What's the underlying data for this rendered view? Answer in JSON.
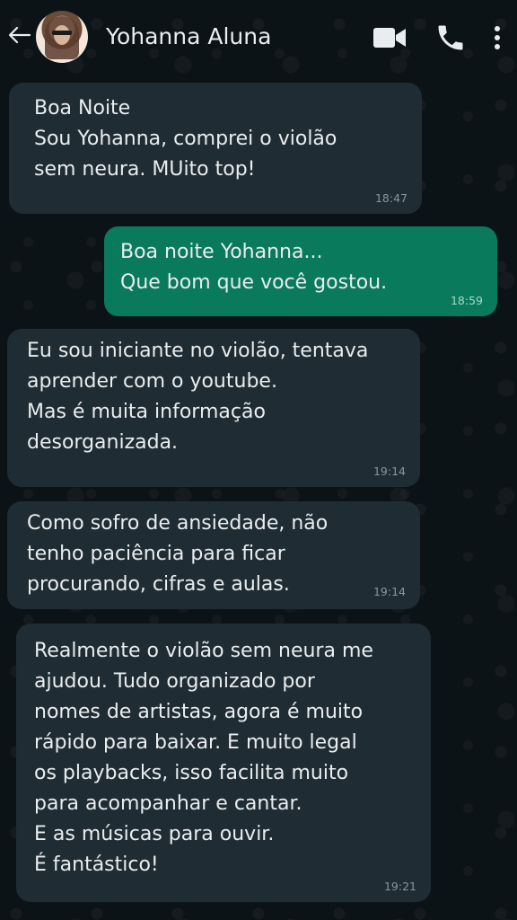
{
  "header": {
    "back_icon": "arrow-left-icon",
    "contact_name": "Yohanna Aluna",
    "icons": [
      "video-camera-icon",
      "phone-icon",
      "more-vert-icon"
    ]
  },
  "colors": {
    "background": "#0c1317",
    "incoming_bubble": "#1f2c34",
    "outgoing_bubble": "#0a7a5c",
    "timestamp": "#8696a0"
  },
  "messages": [
    {
      "direction": "incoming",
      "text": "Boa Noite\nSou Yohanna, comprei o violão\nsem neura. MUito top!",
      "time": "18:47"
    },
    {
      "direction": "outgoing",
      "text": "Boa noite Yohanna...\nQue bom que você gostou.",
      "time": "18:59"
    },
    {
      "direction": "incoming",
      "text": "Eu sou iniciante no violão, tentava\naprender com o youtube.\nMas é muita informação\ndesorganizada.",
      "time": "19:14"
    },
    {
      "direction": "incoming",
      "text": "Como sofro de ansiedade, não\ntenho paciência para ficar\nprocurando, cifras e aulas.",
      "time": "19:14"
    },
    {
      "direction": "incoming",
      "text": "Realmente o violão sem neura me\najudou. Tudo organizado por\nnomes de artistas, agora é muito\nrápido para baixar. E muito legal\nos playbacks, isso facilita muito\npara acompanhar e cantar.\nE as músicas para ouvir.\nÉ fantástico!",
      "time": "19:21"
    }
  ]
}
